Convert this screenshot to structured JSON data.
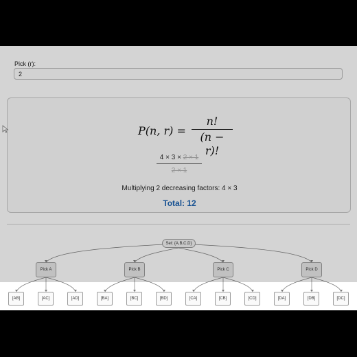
{
  "pick": {
    "label": "Pick (r):",
    "value": "2"
  },
  "formula": {
    "lhs": "P(n, r) =",
    "numerator": "n!",
    "denominator": "(n − r)!"
  },
  "calculation": {
    "numerator_kept": "4 × 3 × ",
    "numerator_cancelled": "2 × 1",
    "denominator": "2 × 1"
  },
  "explanation": "Multiplying 2 decreasing factors: 4 × 3",
  "total": "Total: 12",
  "tree": {
    "root": "Set: {A,B,C,D}",
    "picks": [
      "Pick A",
      "Pick B",
      "Pick C",
      "Pick D"
    ],
    "leaves": [
      "[AB]",
      "[AC]",
      "[AD]",
      "[BA]",
      "[BC]",
      "[BD]",
      "[CA]",
      "[CB]",
      "[CD]",
      "[DA]",
      "[DB]",
      "[DC]"
    ]
  },
  "colors": {
    "total": "#1d63b0",
    "overlay": "rgba(0,0,0,0.17)"
  }
}
